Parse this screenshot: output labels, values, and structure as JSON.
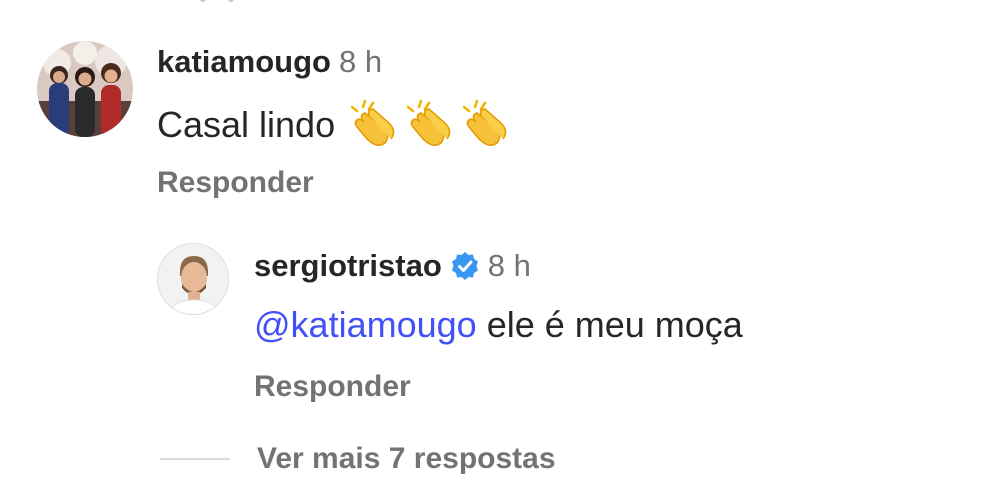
{
  "comment": {
    "username": "katiamougo",
    "time": "8 h",
    "text": "Casal lindo",
    "emojis": [
      "clapping-hands",
      "clapping-hands",
      "clapping-hands"
    ],
    "reply_label": "Responder"
  },
  "reply": {
    "username": "sergiotristao",
    "verified": true,
    "time": "8 h",
    "mention": "@katiamougo",
    "text": "ele é meu moça",
    "reply_label": "Responder"
  },
  "view_more_label": "Ver mais 7 respostas",
  "colors": {
    "text": "#262626",
    "secondary": "#737373",
    "mention": "#4150f7",
    "verified": "#3897f0"
  }
}
